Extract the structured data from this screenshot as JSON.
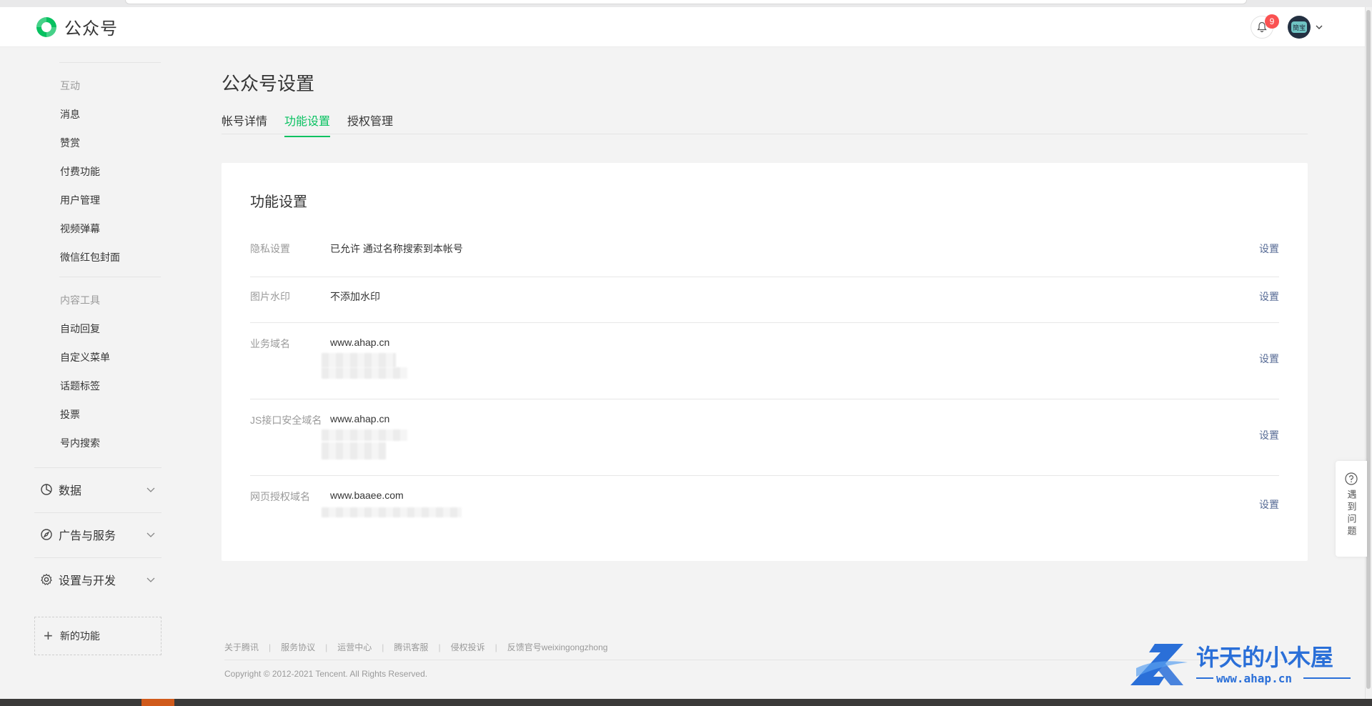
{
  "header": {
    "app_name": "公众号",
    "notification_count": "9",
    "avatar_text": "簡宝"
  },
  "sidebar": {
    "interaction_group": {
      "title": "互动",
      "items": [
        "消息",
        "赞赏",
        "付费功能",
        "用户管理",
        "视频弹幕",
        "微信红包封面"
      ]
    },
    "content_group": {
      "title": "内容工具",
      "items": [
        "自动回复",
        "自定义菜单",
        "话题标签",
        "投票",
        "号内搜索"
      ]
    },
    "sections": [
      "数据",
      "广告与服务",
      "设置与开发"
    ],
    "new_feature": "新的功能"
  },
  "main": {
    "page_title": "公众号设置",
    "tabs": [
      "帐号详情",
      "功能设置",
      "授权管理"
    ],
    "active_tab": "功能设置",
    "card": {
      "title": "功能设置",
      "rows": [
        {
          "label": "隐私设置",
          "value": "已允许 通过名称搜索到本帐号",
          "action": "设置"
        },
        {
          "label": "图片水印",
          "value": "不添加水印",
          "action": "设置"
        },
        {
          "label": "业务域名",
          "value": "www.ahap.cn",
          "action": "设置"
        },
        {
          "label": "JS接口安全域名",
          "value": "www.ahap.cn",
          "action": "设置"
        },
        {
          "label": "网页授权域名",
          "value": "www.baaee.com",
          "action": "设置"
        }
      ]
    }
  },
  "help": {
    "label": "遇到问题"
  },
  "footer": {
    "links": [
      "关于腾讯",
      "服务协议",
      "运营中心",
      "腾讯客服",
      "侵权投诉",
      "反馈官号weixingongzhong"
    ],
    "copyright": "Copyright © 2012-2021 Tencent. All Rights Reserved."
  },
  "watermark": {
    "title": "许天的小木屋",
    "url": "www.ahap.cn"
  },
  "colors": {
    "accent": "#07c160",
    "link": "#576b95",
    "badge": "#fa5151"
  }
}
